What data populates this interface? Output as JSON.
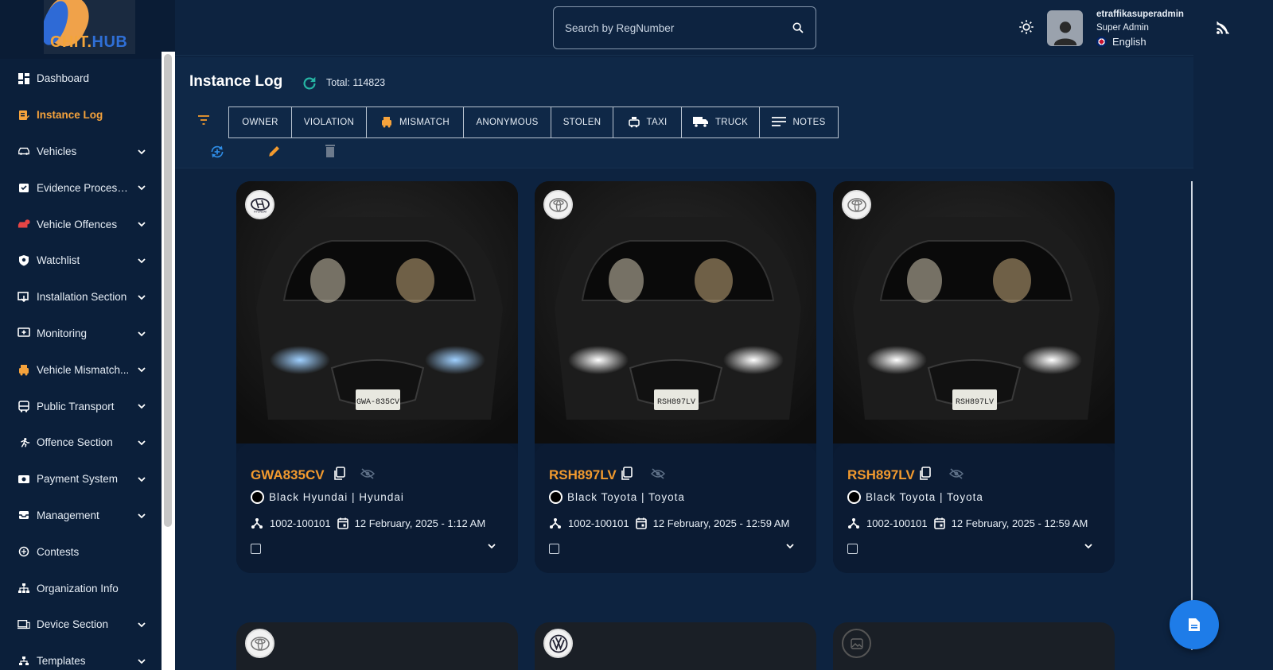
{
  "brand": {
    "part1": "CHIT.",
    "part2": "HUB"
  },
  "sidebar": {
    "items": [
      {
        "label": "Dashboard",
        "icon": "dashboard-icon",
        "chevron": false
      },
      {
        "label": "Instance Log",
        "icon": "log-icon",
        "chevron": false,
        "active": true
      },
      {
        "label": "Vehicles",
        "icon": "car-icon",
        "chevron": true
      },
      {
        "label": "Evidence Processi...",
        "icon": "evidence-icon",
        "chevron": true
      },
      {
        "label": "Vehicle Offences",
        "icon": "offence-car-icon",
        "chevron": true
      },
      {
        "label": "Watchlist",
        "icon": "shield-icon",
        "chevron": true
      },
      {
        "label": "Installation Section",
        "icon": "install-icon",
        "chevron": true
      },
      {
        "label": "Monitoring",
        "icon": "monitor-plus-icon",
        "chevron": true
      },
      {
        "label": "Vehicle Mismatch...",
        "icon": "mismatch-car-icon",
        "chevron": true
      },
      {
        "label": "Public Transport",
        "icon": "bus-icon",
        "chevron": true
      },
      {
        "label": "Offence Section",
        "icon": "runner-icon",
        "chevron": true
      },
      {
        "label": "Payment System",
        "icon": "payment-icon",
        "chevron": true
      },
      {
        "label": "Management",
        "icon": "inbox-icon",
        "chevron": true
      },
      {
        "label": "Contests",
        "icon": "contest-icon",
        "chevron": false
      },
      {
        "label": "Organization Info",
        "icon": "org-icon",
        "chevron": false
      },
      {
        "label": "Device Section",
        "icon": "devices-icon",
        "chevron": true
      },
      {
        "label": "Templates",
        "icon": "template-icon",
        "chevron": true
      }
    ]
  },
  "header": {
    "search_placeholder": "Search by RegNumber",
    "user_name": "etraffikasuperadmin",
    "user_role": "Super Admin",
    "language": "English"
  },
  "page": {
    "title": "Instance Log",
    "total": "Total: 114823"
  },
  "tabs": [
    {
      "label": "OWNER",
      "icon": ""
    },
    {
      "label": "VIOLATION",
      "icon": ""
    },
    {
      "label": "MISMATCH",
      "icon": "mismatch-car-icon"
    },
    {
      "label": "ANONYMOUS",
      "icon": ""
    },
    {
      "label": "STOLEN",
      "icon": ""
    },
    {
      "label": "TAXI",
      "icon": "taxi-icon"
    },
    {
      "label": "TRUCK",
      "icon": "truck-icon"
    },
    {
      "label": "NOTES",
      "icon": "notes-icon"
    }
  ],
  "cards": [
    {
      "plate": "GWA835CV",
      "vehicle": "Black Hyundai | Hyundai",
      "camera": "1002-100101",
      "datetime": "12 February, 2025 - 1:12 AM",
      "brand_logo": "hyundai-logo",
      "plate_on_image": "GWA-835CV"
    },
    {
      "plate": "RSH897LV",
      "vehicle": "Black Toyota | Toyota",
      "camera": "1002-100101",
      "datetime": "12 February, 2025 - 12:59 AM",
      "brand_logo": "toyota-logo",
      "plate_on_image": "RSH897LV"
    },
    {
      "plate": "RSH897LV",
      "vehicle": "Black Toyota | Toyota",
      "camera": "1002-100101",
      "datetime": "12 February, 2025 - 12:59 AM",
      "brand_logo": "toyota-logo",
      "plate_on_image": "RSH897LV"
    }
  ],
  "colors": {
    "accent": "#f29a2e",
    "background": "#0d2340",
    "fab": "#1e7ce8",
    "active_nav": "#f6a33c"
  }
}
